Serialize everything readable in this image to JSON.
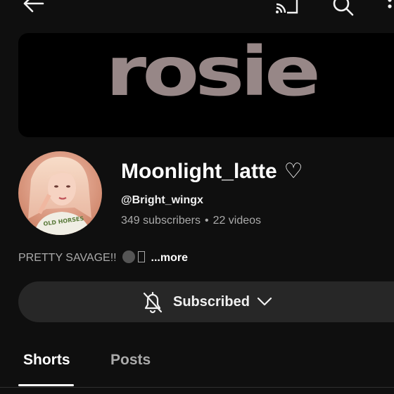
{
  "banner": {
    "text": "rosie"
  },
  "channel": {
    "name": "Moonlight_latte",
    "name_suffix": "♡",
    "handle": "@Bright_wingx",
    "subscribers": "349 subscribers",
    "separator": "•",
    "videos": "22 videos"
  },
  "description": {
    "text": "PRETTY SAVAGE!!",
    "more_label": "...more"
  },
  "subscribe_button": {
    "label": "Subscribed"
  },
  "tabs": [
    {
      "label": "Shorts",
      "selected": true
    },
    {
      "label": "Posts",
      "selected": false
    }
  ],
  "icons": {
    "back": "arrow-left-icon",
    "cast": "cast-icon",
    "search": "search-icon",
    "menu": "more-vertical-icon",
    "notifications": "bell-off-icon",
    "dropdown": "chevron-down-icon"
  },
  "colors": {
    "background": "#0f0f0f",
    "button_bg": "#272727",
    "banner_text": "#978787",
    "secondary_text": "#aaaaaa"
  }
}
